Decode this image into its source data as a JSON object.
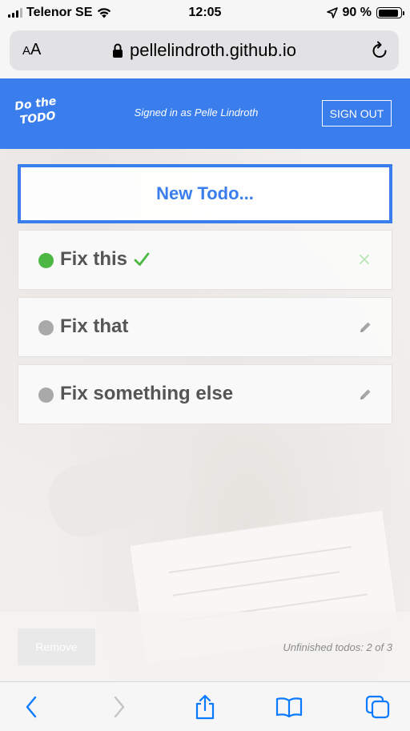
{
  "status_bar": {
    "carrier": "Telenor SE",
    "time": "12:05",
    "battery": "90 %",
    "battery_level": 0.9
  },
  "browser": {
    "text_size_label": "A",
    "text_size_label_large": "A",
    "url": "pellelindroth.github.io"
  },
  "app": {
    "logo_line1": "Do the",
    "logo_line2": "TODO",
    "signed_in_text": "Signed in as Pelle Lindroth",
    "sign_out_label": "SIGN OUT",
    "new_todo_label": "New Todo...",
    "todos": [
      {
        "text": "Fix this",
        "done": true,
        "status_color": "#4cb843",
        "action_icon": "close-icon"
      },
      {
        "text": "Fix that",
        "done": false,
        "status_color": "#a9a9a9",
        "action_icon": "pencil-icon"
      },
      {
        "text": "Fix something else",
        "done": false,
        "status_color": "#a9a9a9",
        "action_icon": "pencil-icon"
      }
    ],
    "remove_label": "Remove",
    "unfinished_text": "Unfinished todos: 2 of 3"
  },
  "toolbar": {
    "icons": [
      "back-icon",
      "forward-icon",
      "share-icon",
      "bookmarks-icon",
      "tabs-icon"
    ]
  },
  "colors": {
    "accent": "#3a7ded",
    "done": "#4cb843",
    "pending": "#a9a9a9",
    "ios_blue": "#0a7aff"
  }
}
